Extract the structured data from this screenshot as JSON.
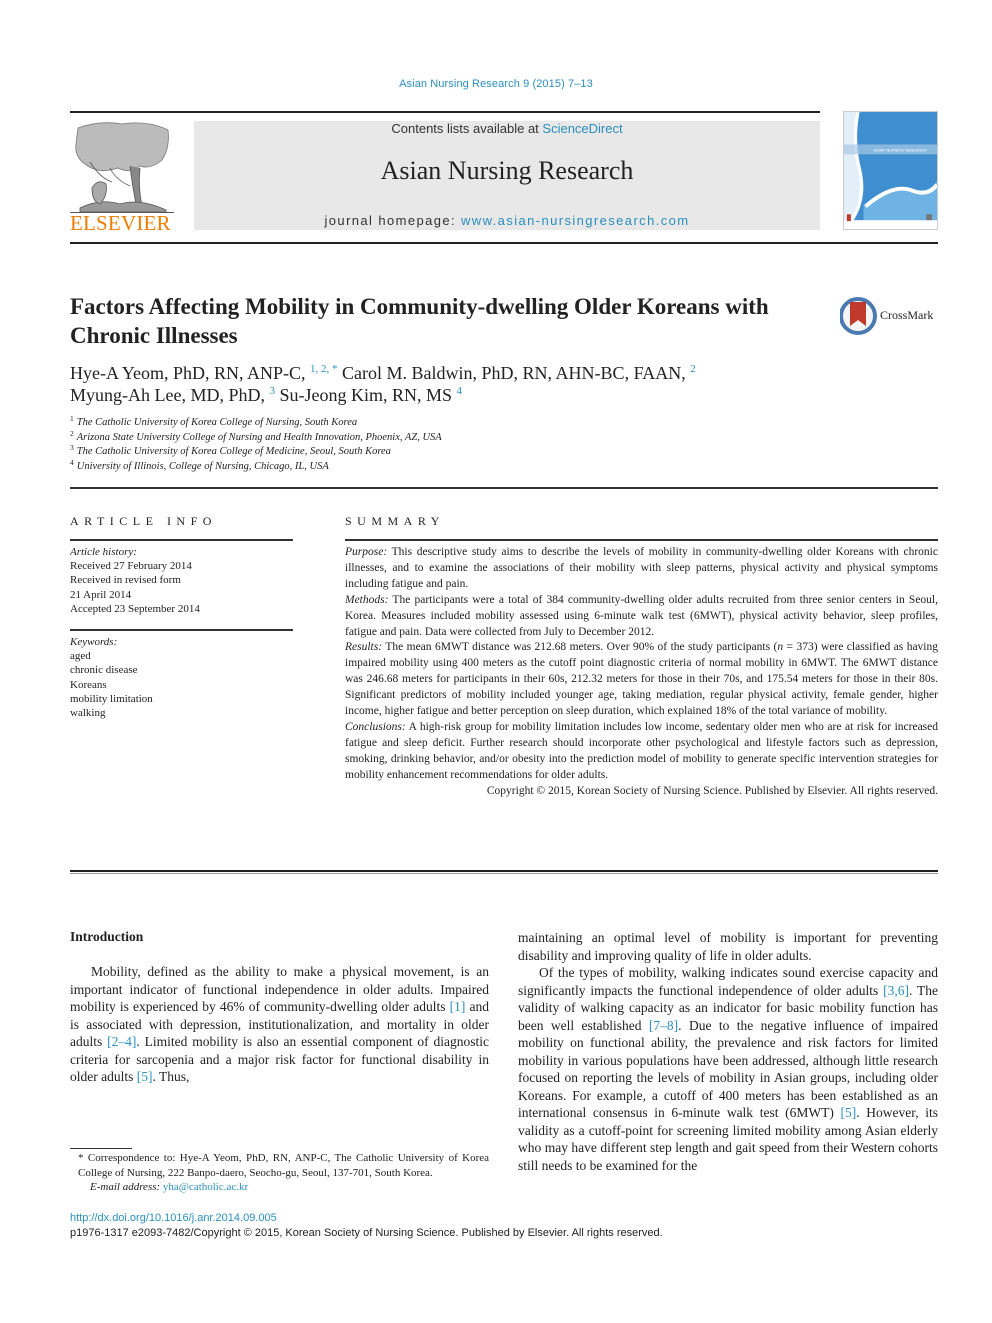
{
  "running_head": "Asian Nursing Research 9 (2015) 7–13",
  "publisher": {
    "name": "ELSEVIER",
    "brand_color": "#f07d00"
  },
  "masthead": {
    "contents_prefix": "Contents lists available at ",
    "contents_link": "ScienceDirect",
    "journal_name": "Asian Nursing Research",
    "homepage_prefix": "journal homepage: ",
    "homepage_link": "www.asian-nursingresearch.com",
    "link_color": "#2a8fbd"
  },
  "cover": {
    "label": "ASIAN NURSING RESEARCH"
  },
  "crossmark": {
    "label": "CrossMark"
  },
  "article": {
    "title": "Factors Affecting Mobility in Community-dwelling Older Koreans with Chronic Illnesses",
    "authors": [
      {
        "name": "Hye-A Yeom, PhD, RN, ANP-C,",
        "affil": "1, 2, *"
      },
      {
        "name": "Carol M. Baldwin, PhD, RN, AHN-BC, FAAN,",
        "affil": "2"
      },
      {
        "name": "Myung-Ah Lee, MD, PhD,",
        "affil": "3"
      },
      {
        "name": "Su-Jeong Kim, RN, MS",
        "affil": "4"
      }
    ],
    "affiliations": [
      {
        "num": "1",
        "text": "The Catholic University of Korea College of Nursing, South Korea"
      },
      {
        "num": "2",
        "text": "Arizona State University College of Nursing and Health Innovation, Phoenix, AZ, USA"
      },
      {
        "num": "3",
        "text": "The Catholic University of Korea College of Medicine, Seoul, South Korea"
      },
      {
        "num": "4",
        "text": "University of Illinois, College of Nursing, Chicago, IL, USA"
      }
    ]
  },
  "article_info": {
    "heading": "ARTICLE INFO",
    "history_label": "Article history:",
    "history": [
      "Received 27 February 2014",
      "Received in revised form",
      "21 April 2014",
      "Accepted 23 September 2014"
    ],
    "keywords_label": "Keywords:",
    "keywords": [
      "aged",
      "chronic disease",
      "Koreans",
      "mobility limitation",
      "walking"
    ]
  },
  "summary": {
    "heading": "SUMMARY",
    "purpose_label": "Purpose:",
    "purpose": "This descriptive study aims to describe the levels of mobility in community-dwelling older Koreans with chronic illnesses, and to examine the associations of their mobility with sleep patterns, physical activity and physical symptoms including fatigue and pain.",
    "methods_label": "Methods:",
    "methods": "The participants were a total of 384 community-dwelling older adults recruited from three senior centers in Seoul, Korea. Measures included mobility assessed using 6-minute walk test (6MWT), physical activity behavior, sleep profiles, fatigue and pain. Data were collected from July to December 2012.",
    "results_label": "Results:",
    "results_a": "The mean 6MWT distance was 212.68 meters. Over 90% of the study participants (",
    "results_n": "n",
    "results_b": " = 373) were classified as having impaired mobility using 400 meters as the cutoff point diagnostic criteria of normal mobility in 6MWT. The 6MWT distance was 246.68 meters for participants in their 60s, 212.32 meters for those in their 70s, and 175.54 meters for those in their 80s. Significant predictors of mobility included younger age, taking mediation, regular physical activity, female gender, higher income, higher fatigue and better perception on sleep duration, which explained 18% of the total variance of mobility.",
    "conclusions_label": "Conclusions:",
    "conclusions": "A high-risk group for mobility limitation includes low income, sedentary older men who are at risk for increased fatigue and sleep deficit. Further research should incorporate other psychological and lifestyle factors such as depression, smoking, drinking behavior, and/or obesity into the prediction model of mobility to generate specific intervention strategies for mobility enhancement recommendations for older adults.",
    "copyright": "Copyright © 2015, Korean Society of Nursing Science. Published by Elsevier. All rights reserved."
  },
  "body": {
    "intro_heading": "Introduction",
    "left_p1_a": "Mobility, defined as the ability to make a physical movement, is an important indicator of functional independence in older adults. Impaired mobility is experienced by 46% of community-dwelling older adults ",
    "left_ref1": "[1]",
    "left_p1_b": " and is associated with depression, institutionalization, and mortality in older adults ",
    "left_ref2": "[2–4]",
    "left_p1_c": ". Limited mobility is also an essential component of diagnostic criteria for sarcopenia and a major risk factor for functional disability in older adults ",
    "left_ref3": "[5]",
    "left_p1_d": ". Thus,",
    "right_p1": "maintaining an optimal level of mobility is important for preventing disability and improving quality of life in older adults.",
    "right_p2_a": "Of the types of mobility, walking indicates sound exercise capacity and significantly impacts the functional independence of older adults ",
    "right_ref1": "[3,6]",
    "right_p2_b": ". The validity of walking capacity as an indicator for basic mobility function has been well established ",
    "right_ref2": "[7–8]",
    "right_p2_c": ". Due to the negative influence of impaired mobility on functional ability, the prevalence and risk factors for limited mobility in various populations have been addressed, although little research focused on reporting the levels of mobility in Asian groups, including older Koreans. For example, a cutoff of 400 meters has been established as an international consensus in 6-minute walk test (6MWT) ",
    "right_ref3": "[5]",
    "right_p2_d": ". However, its validity as a cutoff-point for screening limited mobility among Asian elderly who may have different step length and gait speed from their Western cohorts still needs to be examined for the"
  },
  "footnote": {
    "correspondence": "* Correspondence to: Hye-A Yeom, PhD, RN, ANP-C, The Catholic University of Korea College of Nursing, 222 Banpo-daero, Seocho-gu, Seoul, 137-701, South Korea.",
    "email_label": "E-mail address:",
    "email": "yha@catholic.ac.kr"
  },
  "footer": {
    "doi": "http://dx.doi.org/10.1016/j.anr.2014.09.005",
    "issn": "p1976-1317 e2093-7482/Copyright © 2015, Korean Society of Nursing Science. Published by Elsevier. All rights reserved."
  }
}
